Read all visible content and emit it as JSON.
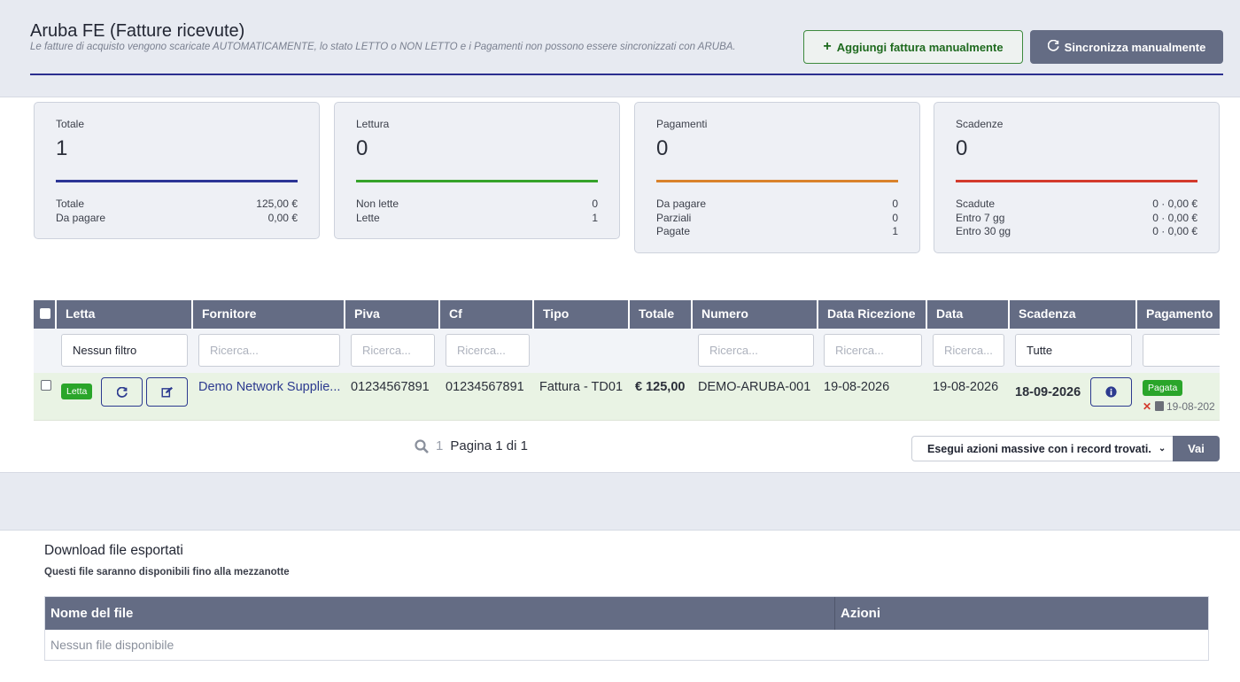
{
  "header": {
    "title": "Aruba FE (Fatture ricevute)",
    "subtitle": "Le fatture di acquisto vengono scaricate AUTOMATICAMENTE, lo stato LETTO o NON LETTO e i Pagamenti non possono essere sincronizzati con ARUBA.",
    "add_button": "Aggiungi fattura manualmente",
    "sync_button": "Sincronizza manualmente"
  },
  "cards": [
    {
      "label": "Totale",
      "value": "1",
      "color": "#2c3595",
      "rows": [
        {
          "k": "Totale",
          "v": "125,00 €"
        },
        {
          "k": "Da pagare",
          "v": "0,00 €"
        }
      ]
    },
    {
      "label": "Lettura",
      "value": "0",
      "color": "#36a32a",
      "rows": [
        {
          "k": "Non lette",
          "v": "0"
        },
        {
          "k": "Lette",
          "v": "1"
        }
      ]
    },
    {
      "label": "Pagamenti",
      "value": "0",
      "color": "#d9822b",
      "rows": [
        {
          "k": "Da pagare",
          "v": "0"
        },
        {
          "k": "Parziali",
          "v": "0"
        },
        {
          "k": "Pagate",
          "v": "1"
        }
      ]
    },
    {
      "label": "Scadenze",
      "value": "0",
      "color": "#d33a2c",
      "rows": [
        {
          "k": "Scadute",
          "v": "0 · 0,00 €"
        },
        {
          "k": "Entro 7 gg",
          "v": "0 · 0,00 €"
        },
        {
          "k": "Entro 30 gg",
          "v": "0 · 0,00 €"
        }
      ]
    }
  ],
  "table": {
    "columns": [
      "Letta",
      "Fornitore",
      "Piva",
      "Cf",
      "Tipo",
      "Totale",
      "Numero",
      "Data Ricezione",
      "Data",
      "Scadenza",
      "Pagamento"
    ],
    "filters": {
      "letta": "Nessun filtro",
      "placeholder": "Ricerca...",
      "scadenza": "Tutte"
    },
    "row": {
      "letta_badge": "Letta",
      "fornitore": "Demo Network Supplie...",
      "piva": "01234567891",
      "cf": "01234567891",
      "tipo": "Fattura - TD01",
      "totale": "€ 125,00",
      "numero": "DEMO-ARUBA-001",
      "data_ricezione": "19-08-2026",
      "data": "19-08-2026",
      "scadenza": "18-09-2026",
      "pagamento_badge": "Pagata",
      "pagamento_date": "19-08-202"
    }
  },
  "pager": {
    "page_num": "1",
    "page_text": "Pagina 1 di 1",
    "mass_action": "Esegui azioni massive con i record trovati.",
    "go": "Vai"
  },
  "downloads": {
    "title": "Download file esportati",
    "subtitle": "Questi file saranno disponibili fino alla mezzanotte",
    "col_name": "Nome del file",
    "col_actions": "Azioni",
    "empty": "Nessun file disponibile"
  }
}
